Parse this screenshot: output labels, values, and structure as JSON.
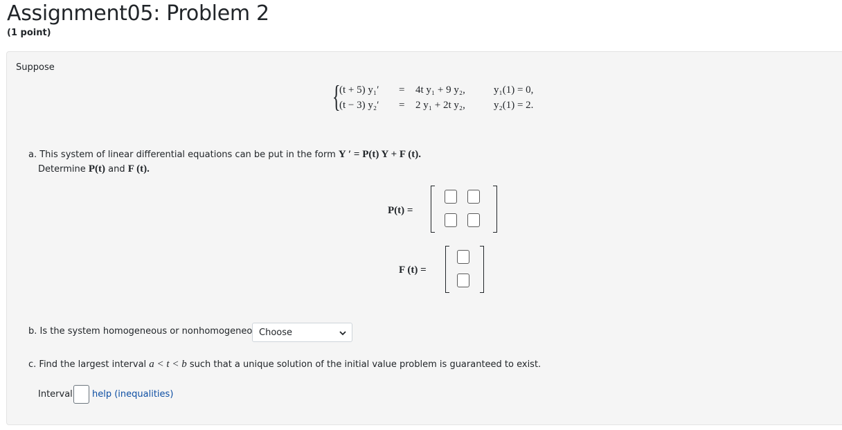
{
  "page": {
    "title": "Assignment05: Problem 2",
    "points": "(1 point)"
  },
  "problem": {
    "intro": "Suppose",
    "system": {
      "eq1_lhs": "(t + 5) y₁′",
      "eq1_eq": "=",
      "eq1_rhs": "4t y₁ + 9 y₂,",
      "eq1_ic": "y₁(1) = 0,",
      "eq2_lhs": "(t − 3) y₂′",
      "eq2_eq": "=",
      "eq2_rhs": "2 y₁ + 2t y₂,",
      "eq2_ic": "y₂(1) = 2."
    },
    "part_a": {
      "text": "a. This system of linear differential equations can be put in the form",
      "form": "Y ′ = P(t) Y + F (t).",
      "determine_prefix": "Determine",
      "determine_p": "P(t)",
      "determine_and": "and",
      "determine_f": "F (t).",
      "p_label": "P(t) =",
      "f_label": "F (t) ="
    },
    "part_b": {
      "text": "b. Is the system homogeneous or nonhomogeneous?",
      "select_value": "Choose"
    },
    "part_c": {
      "text_prefix": "c. Find the largest interval",
      "interval_expr": "a < t < b",
      "text_suffix": "such that a unique solution of the initial value problem is guaranteed to exist.",
      "interval_label": "Interval:",
      "help_link": "help (inequalities)"
    }
  },
  "colors": {
    "box_background": "#f5f5f5",
    "link": "#0d4ea3"
  },
  "icons": {
    "select_arrow": "chevron-down-icon"
  }
}
